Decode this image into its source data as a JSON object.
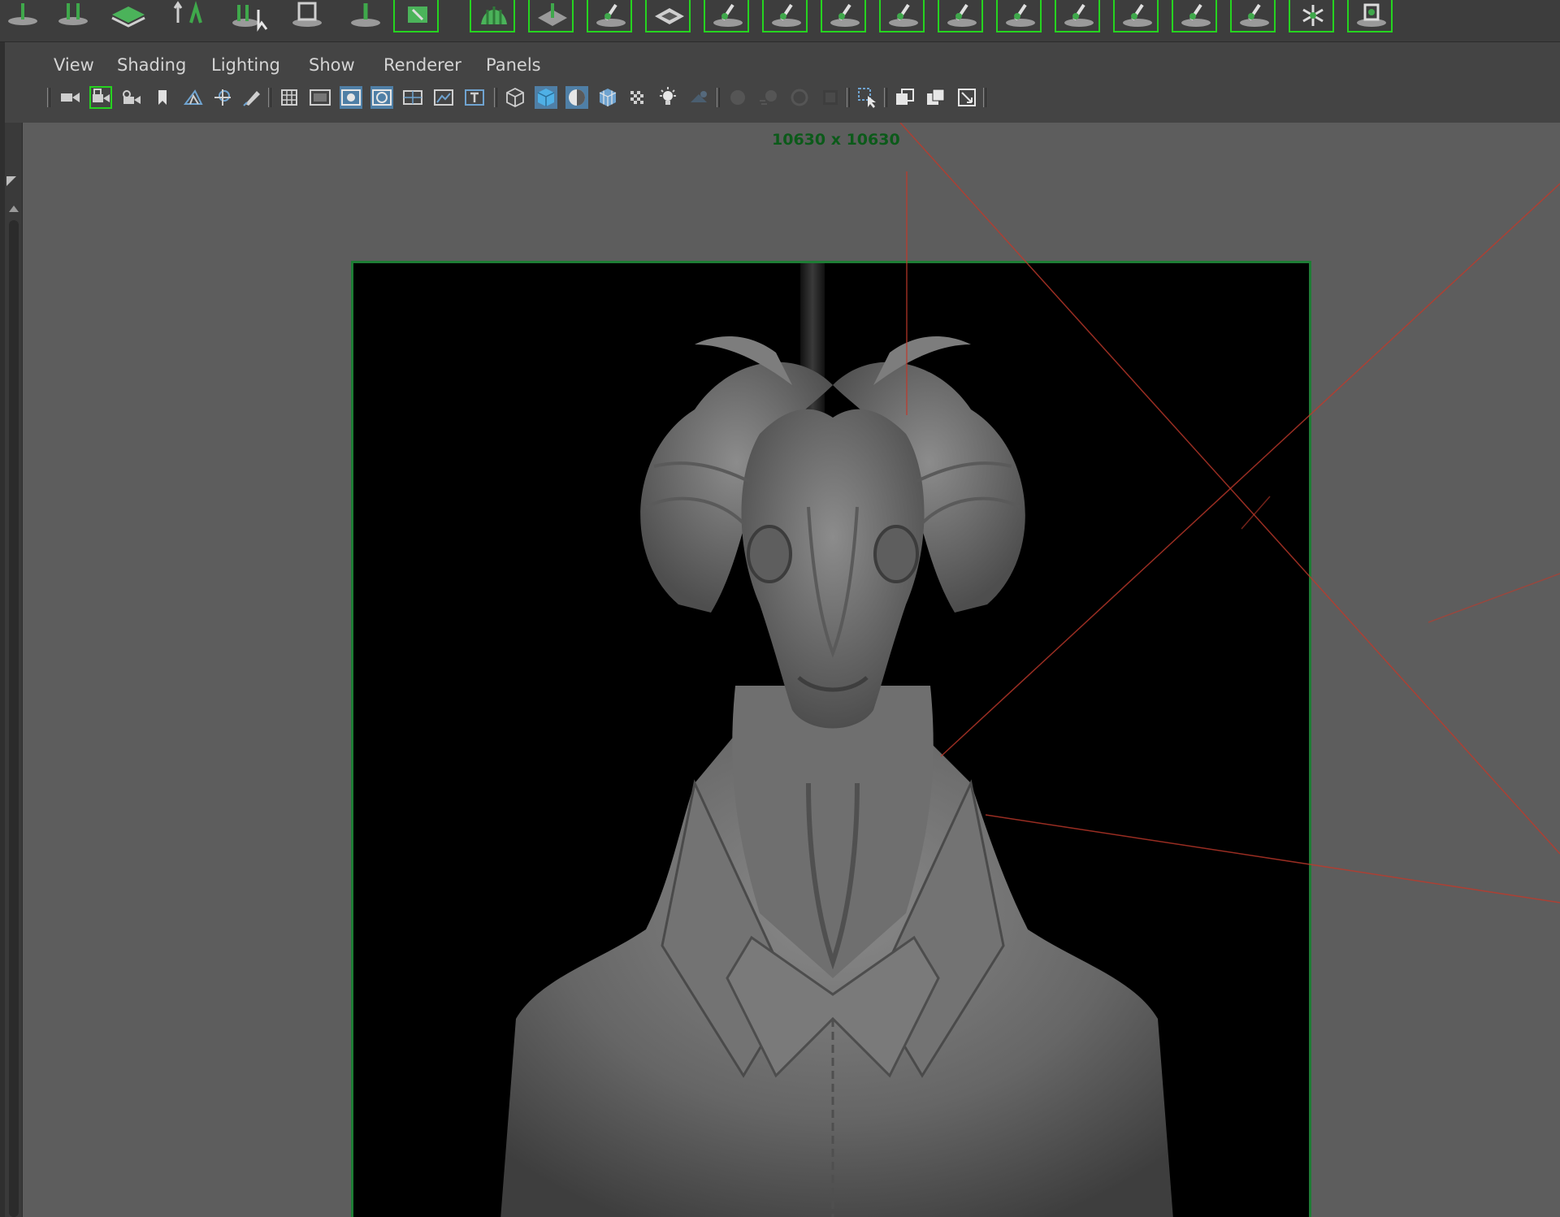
{
  "menubar": {
    "items": [
      "View",
      "Shading",
      "Lighting",
      "Show",
      "Renderer",
      "Panels"
    ]
  },
  "viewport": {
    "resolution_gate_label": "10630 x 10630"
  },
  "shelf": {
    "icons": [
      "sculpt-tool-icon",
      "sculpt-tool-icon",
      "flatten-tool-icon",
      "move-sculpt-icon",
      "select-sculpt-icon",
      "smooth-tool-icon",
      "relax-tool-icon",
      "pinch-tool-icon",
      "grab-tool-icon",
      "repeat-tool-icon",
      "fill-tool-icon",
      "knife-tool-icon",
      "scrape-tool-icon",
      "sculpt-brush-icon",
      "sculpt-brush-icon",
      "sculpt-brush-icon",
      "sculpt-brush-icon",
      "sculpt-brush-icon",
      "sculpt-brush-icon",
      "sculpt-brush-icon",
      "sculpt-brush-icon",
      "sculpt-brush-icon",
      "freeze-tool-icon",
      "sculpt-brush-icon"
    ]
  },
  "toolbar": {
    "icons": [
      "select-camera-icon",
      "lock-camera-icon",
      "camera-attributes-icon",
      "bookmark-icon",
      "image-plane-icon",
      "2d-pan-zoom-icon",
      "grease-pencil-icon",
      "grid-icon",
      "film-gate-icon",
      "resolution-gate-icon",
      "gate-mask-icon",
      "field-chart-icon",
      "safe-action-icon",
      "safe-title-icon",
      "wireframe-icon",
      "smooth-shade-icon",
      "default-material-icon",
      "wireframe-on-shaded-icon",
      "textured-icon",
      "use-all-lights-icon",
      "shadows-icon",
      "screen-space-ao-icon",
      "motion-blur-icon",
      "anti-aliasing-icon",
      "depth-of-field-icon",
      "isolate-select-icon",
      "xray-icon",
      "xray-active-icon",
      "xray-joints-icon"
    ]
  },
  "colors": {
    "viewport_bg": "#5d5d5d",
    "image_plane_bg": "#000000",
    "gate_border": "#1e7d35",
    "gate_label": "#0c5a1a",
    "active_highlight": "#25d41f",
    "camera_line": "#c0392b"
  }
}
